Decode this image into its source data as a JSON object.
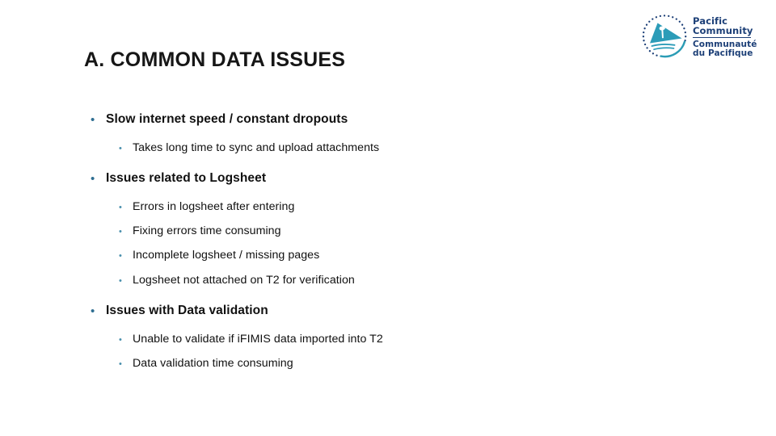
{
  "slide": {
    "title": "A. COMMON DATA ISSUES",
    "background_color": "#ffffff",
    "title_color": "#161616"
  },
  "logo": {
    "name": "pacific-community-logo",
    "emblem_icon": "spc-sail-canoe-emblem-icon",
    "line_en_1": "Pacific",
    "line_en_2": "Community",
    "line_fr_1": "Communauté",
    "line_fr_2": "du Pacifique",
    "text_color": "#1c3f77",
    "emblem_teal": "#2b9cb5",
    "emblem_dark": "#1c3f77"
  },
  "bullets": {
    "level1_marker": "•",
    "level2_marker": "•",
    "level1_marker_color": "#2e6e91",
    "level2_marker_color": "#4a90ad",
    "groups": [
      {
        "heading": "Slow internet speed / constant dropouts",
        "sub": [
          "Takes long time to sync and upload attachments"
        ]
      },
      {
        "heading": "Issues related to Logsheet",
        "sub": [
          "Errors in logsheet after entering",
          "Fixing errors time consuming",
          "Incomplete logsheet / missing pages",
          "Logsheet not attached on T2 for verification"
        ]
      },
      {
        "heading": "Issues with Data validation",
        "sub": [
          "Unable to validate if iFIMIS data imported into T2",
          "Data validation time consuming"
        ]
      }
    ]
  }
}
